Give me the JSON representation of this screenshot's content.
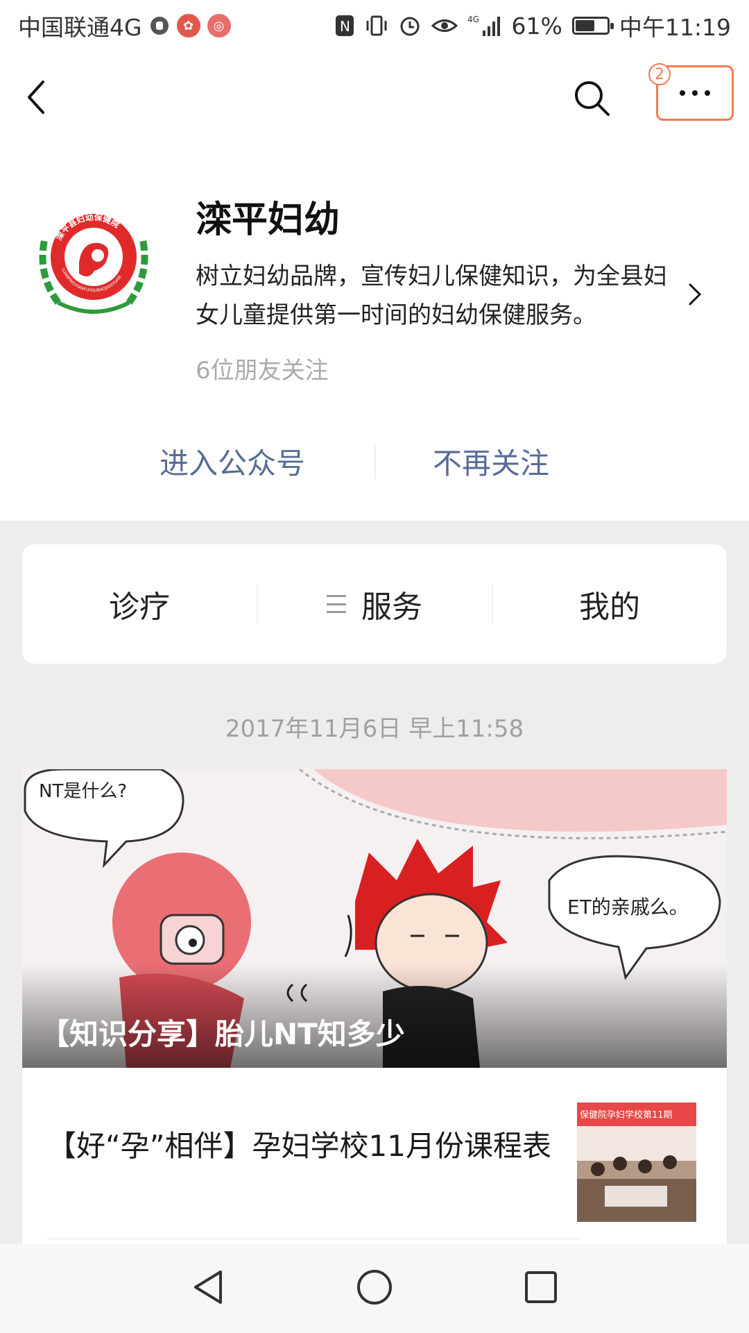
{
  "status_bar": {
    "carrier": "中国联通4G",
    "battery_percent": "61%",
    "battery_level": 0.61,
    "time": "中午11:19",
    "network": "4G",
    "icons": [
      "hand-icon",
      "app-icon-red",
      "app-icon-pink",
      "nfc-icon",
      "vibrate-icon",
      "alarm-icon",
      "eye-icon",
      "signal-icon",
      "battery-icon"
    ]
  },
  "nav": {
    "back_icon": "chevron-left-icon",
    "search_icon": "search-icon",
    "more_icon": "more-dots-icon",
    "more_badge": "2"
  },
  "account": {
    "name": "滦平妇幼",
    "logo_text": "滦平县妇幼保健院",
    "logo_sub": "LUANPINGXIANFUYOUBAOJIANYUAN",
    "description": "树立妇幼品牌，宣传妇儿保健知识，为全县妇女儿童提供第一时间的妇幼保健服务。",
    "followers": "6位朋友关注",
    "actions": {
      "enter": "进入公众号",
      "unfollow": "不再关注"
    }
  },
  "menu": {
    "items": [
      {
        "label": "诊疗"
      },
      {
        "label": "服务"
      },
      {
        "label": "我的"
      }
    ]
  },
  "feed": {
    "timestamp": "2017年11月6日 早上11:58",
    "cover_article": {
      "title": "【知识分享】胎儿NT知多少",
      "bubble_left": "NT是什么?",
      "bubble_right": "ET的亲戚么。"
    },
    "sub_article": {
      "title": "【好“孕”相伴】孕妇学校11月份课程表",
      "thumb_banner": "保健院孕妇学校第11期"
    }
  },
  "colors": {
    "link_blue": "#576b95",
    "highlight_orange": "#f37b52",
    "page_bg": "#ededed",
    "logo_red": "#e02a2a",
    "logo_green": "#2e9a3c"
  }
}
